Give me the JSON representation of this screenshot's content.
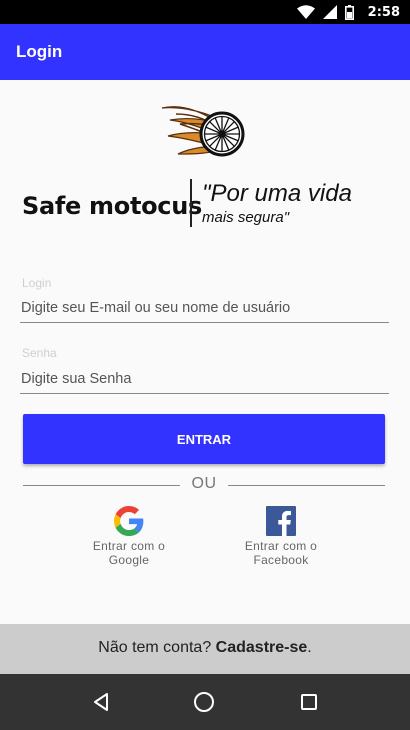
{
  "status_bar": {
    "time": "2:58",
    "icons": [
      "wifi-icon",
      "signal-icon",
      "battery-icon"
    ]
  },
  "app_bar": {
    "title": "Login"
  },
  "brand": {
    "name": "Safe motocus",
    "slogan_line1": "\"Por uma vida",
    "slogan_line2": "mais segura\"",
    "logo_icon": "flaming-wheel-icon"
  },
  "login_field": {
    "label": "Login",
    "placeholder": "Digite seu E-mail ou seu nome de usuário",
    "value": ""
  },
  "password_field": {
    "label": "Senha",
    "placeholder": "Digite sua Senha",
    "value": ""
  },
  "login_button": {
    "label": "ENTRAR"
  },
  "divider": {
    "label": "OU"
  },
  "social": {
    "google": {
      "label": "Entrar com o Google",
      "icon": "google-icon"
    },
    "facebook": {
      "label": "Entrar com o Facebook",
      "icon": "facebook-icon"
    }
  },
  "signup": {
    "prompt": "Não tem conta? ",
    "link": "Cadastre-se",
    "suffix": "."
  },
  "nav_bar": {
    "icons": [
      "back-icon",
      "home-icon",
      "recents-icon"
    ]
  },
  "colors": {
    "primary": "#3333ff",
    "status_bar": "#000000",
    "nav_bar": "#333333",
    "signup_bar": "#cccccc"
  }
}
